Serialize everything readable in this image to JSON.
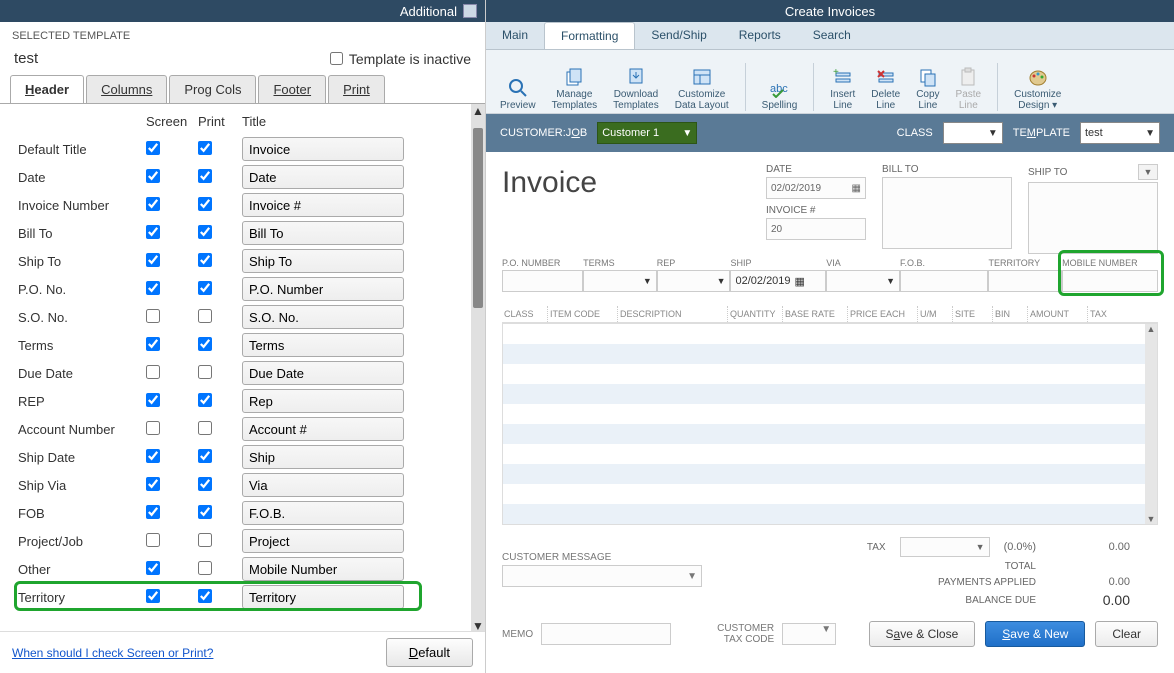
{
  "left": {
    "title_bar": "Additional",
    "selected_template_label": "SELECTED TEMPLATE",
    "template_name": "test",
    "template_inactive_label": "Template is inactive",
    "tabs": {
      "header": "Header",
      "columns": "Columns",
      "prog": "Prog Cols",
      "footer": "Footer",
      "print": "Print"
    },
    "col_heads": {
      "screen": "Screen",
      "print": "Print",
      "title": "Title"
    },
    "rows": [
      {
        "label": "Default Title",
        "screen": true,
        "print": true,
        "title": "Invoice"
      },
      {
        "label": "Date",
        "screen": true,
        "print": true,
        "title": "Date"
      },
      {
        "label": "Invoice Number",
        "screen": true,
        "print": true,
        "title": "Invoice #"
      },
      {
        "label": "Bill To",
        "screen": true,
        "print": true,
        "title": "Bill To"
      },
      {
        "label": "Ship To",
        "screen": true,
        "print": true,
        "title": "Ship To"
      },
      {
        "label": "P.O. No.",
        "screen": true,
        "print": true,
        "title": "P.O. Number"
      },
      {
        "label": "S.O. No.",
        "screen": false,
        "print": false,
        "title": "S.O. No."
      },
      {
        "label": "Terms",
        "screen": true,
        "print": true,
        "title": "Terms"
      },
      {
        "label": "Due Date",
        "screen": false,
        "print": false,
        "title": "Due Date"
      },
      {
        "label": "REP",
        "screen": true,
        "print": true,
        "title": "Rep"
      },
      {
        "label": "Account Number",
        "screen": false,
        "print": false,
        "title": "Account #"
      },
      {
        "label": "Ship Date",
        "screen": true,
        "print": true,
        "title": "Ship"
      },
      {
        "label": "Ship Via",
        "screen": true,
        "print": true,
        "title": "Via"
      },
      {
        "label": "FOB",
        "screen": true,
        "print": true,
        "title": "F.O.B."
      },
      {
        "label": "Project/Job",
        "screen": false,
        "print": false,
        "title": "Project"
      },
      {
        "label": "Other",
        "screen": true,
        "print": false,
        "title": "Mobile Number"
      },
      {
        "label": "Territory",
        "screen": true,
        "print": true,
        "title": "Territory"
      }
    ],
    "help_link": "When should I check Screen or Print?",
    "default_btn": "Default"
  },
  "right": {
    "title_bar": "Create Invoices",
    "ribbon_tabs": {
      "main": "Main",
      "formatting": "Formatting",
      "send": "Send/Ship",
      "reports": "Reports",
      "search": "Search"
    },
    "ribbon": {
      "preview": "Preview",
      "manage1": "Manage",
      "manage2": "Templates",
      "download1": "Download",
      "download2": "Templates",
      "custdl1": "Customize",
      "custdl2": "Data Layout",
      "spelling": "Spelling",
      "insert1": "Insert",
      "insert2": "Line",
      "delete1": "Delete",
      "delete2": "Line",
      "copy1": "Copy",
      "copy2": "Line",
      "paste1": "Paste",
      "paste2": "Line",
      "design1": "Customize",
      "design2": "Design"
    },
    "custbar": {
      "customer_job": "CUSTOMER:JOB",
      "customer_val": "Customer 1",
      "class": "CLASS",
      "template": "TEMPLATE",
      "template_val": "test"
    },
    "invoice": {
      "title": "Invoice",
      "date_lbl": "DATE",
      "date_val": "02/02/2019",
      "invno_lbl": "INVOICE #",
      "invno_val": "20",
      "billto": "BILL TO",
      "shipto": "SHIP TO"
    },
    "strip": {
      "po": "P.O. NUMBER",
      "terms": "TERMS",
      "rep": "REP",
      "ship": "SHIP",
      "ship_val": "02/02/2019",
      "via": "VIA",
      "fob": "F.O.B.",
      "territory": "TERRITORY",
      "mobile": "MOBILE NUMBER"
    },
    "gridcols": [
      "CLASS",
      "ITEM CODE",
      "DESCRIPTION",
      "QUANTITY",
      "BASE RATE",
      "PRICE EACH",
      "U/M",
      "SITE",
      "BIN",
      "AMOUNT",
      "TAX"
    ],
    "totals": {
      "tax_lbl": "TAX",
      "tax_pct": "(0.0%)",
      "tax_val": "0.00",
      "total_lbl": "TOTAL",
      "pay_lbl": "PAYMENTS APPLIED",
      "pay_val": "0.00",
      "bal_lbl": "BALANCE DUE",
      "bal_val": "0.00"
    },
    "msg_lbl": "CUSTOMER MESSAGE",
    "memo_lbl": "MEMO",
    "taxcode_lbl1": "CUSTOMER",
    "taxcode_lbl2": "TAX CODE",
    "actions": {
      "saveclose": "Save & Close",
      "savenew": "Save & New",
      "clear": "Clear"
    }
  }
}
